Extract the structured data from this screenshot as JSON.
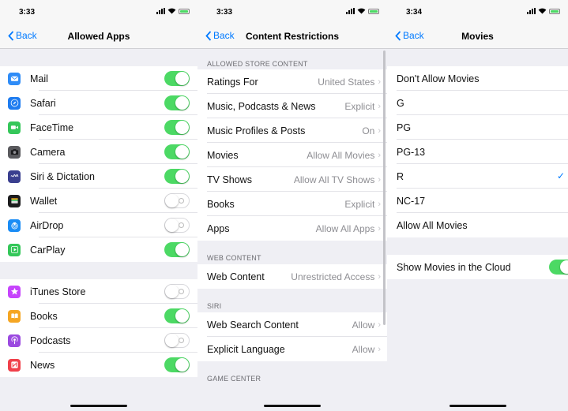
{
  "panels": [
    {
      "time": "3:33",
      "back_label": "Back",
      "title": "Allowed Apps",
      "groups": [
        [
          {
            "label": "Mail",
            "icon": "mail-icon",
            "color": "#2f8cf7",
            "on": true
          },
          {
            "label": "Safari",
            "icon": "safari-icon",
            "color": "#1e7cf0",
            "on": true
          },
          {
            "label": "FaceTime",
            "icon": "facetime-icon",
            "color": "#35c75a",
            "on": true
          },
          {
            "label": "Camera",
            "icon": "camera-icon",
            "color": "#5a5a5e",
            "on": true
          },
          {
            "label": "Siri & Dictation",
            "icon": "siri-icon",
            "color": "#3a3f8f",
            "on": true
          },
          {
            "label": "Wallet",
            "icon": "wallet-icon",
            "color": "#1c1c1e",
            "on": false
          },
          {
            "label": "AirDrop",
            "icon": "airdrop-icon",
            "color": "#1a8cf5",
            "on": false
          },
          {
            "label": "CarPlay",
            "icon": "carplay-icon",
            "color": "#34c759",
            "on": true
          }
        ],
        [
          {
            "label": "iTunes Store",
            "icon": "itunes-store-icon",
            "color": "#c644fc",
            "on": false
          },
          {
            "label": "Books",
            "icon": "books-icon",
            "color": "#f5a623",
            "on": true
          },
          {
            "label": "Podcasts",
            "icon": "podcasts-icon",
            "color": "#9b4ae0",
            "on": false
          },
          {
            "label": "News",
            "icon": "news-icon",
            "color": "#f0404a",
            "on": true
          }
        ]
      ]
    },
    {
      "time": "3:33",
      "back_label": "Back",
      "title": "Content Restrictions",
      "sections": [
        {
          "header": "ALLOWED STORE CONTENT",
          "rows": [
            {
              "label": "Ratings For",
              "value": "United States"
            },
            {
              "label": "Music, Podcasts & News",
              "value": "Explicit"
            },
            {
              "label": "Music Profiles & Posts",
              "value": "On"
            },
            {
              "label": "Movies",
              "value": "Allow All Movies"
            },
            {
              "label": "TV Shows",
              "value": "Allow All TV Shows"
            },
            {
              "label": "Books",
              "value": "Explicit"
            },
            {
              "label": "Apps",
              "value": "Allow All Apps"
            }
          ]
        },
        {
          "header": "WEB CONTENT",
          "rows": [
            {
              "label": "Web Content",
              "value": "Unrestricted Access"
            }
          ]
        },
        {
          "header": "SIRI",
          "rows": [
            {
              "label": "Web Search Content",
              "value": "Allow"
            },
            {
              "label": "Explicit Language",
              "value": "Allow"
            }
          ]
        },
        {
          "header": "GAME CENTER",
          "rows": []
        }
      ]
    },
    {
      "time": "3:34",
      "back_label": "Back",
      "title": "Movies",
      "ratings": [
        {
          "label": "Don't Allow Movies",
          "checked": false
        },
        {
          "label": "G",
          "checked": false
        },
        {
          "label": "PG",
          "checked": false
        },
        {
          "label": "PG-13",
          "checked": false
        },
        {
          "label": "R",
          "checked": true
        },
        {
          "label": "NC-17",
          "checked": false
        },
        {
          "label": "Allow All Movies",
          "checked": false
        }
      ],
      "cloud_toggle": {
        "label": "Show Movies in the Cloud",
        "on": true
      }
    }
  ],
  "colors": {
    "accent": "#007aff",
    "toggle_on": "#4cd964",
    "background": "#efeff4"
  }
}
